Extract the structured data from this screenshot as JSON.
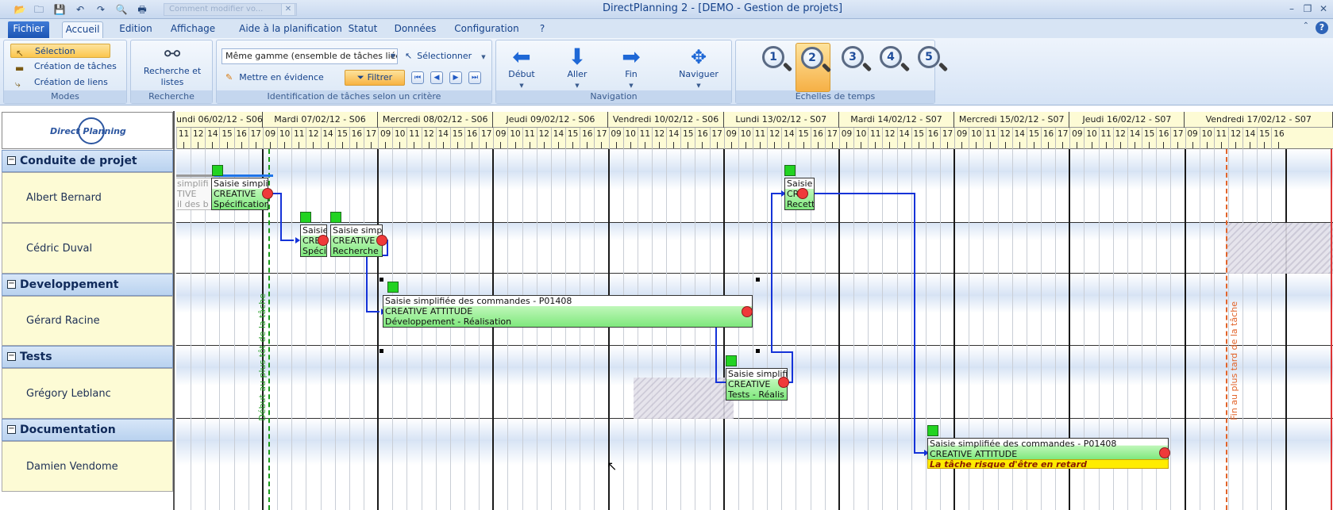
{
  "titlebar": {
    "document_tab": "Comment modifier vo...",
    "title": "DirectPlanning 2 - [DEMO - Gestion de projets]",
    "quick_access_icons": [
      "open-icon",
      "folder-icon",
      "save-icon",
      "undo-icon",
      "redo-icon",
      "print-preview-icon",
      "print-icon"
    ]
  },
  "tabs": [
    "Fichier",
    "Accueil",
    "Edition",
    "Affichage",
    "Aide à la planification",
    "Statut",
    "Données",
    "Configuration",
    "?"
  ],
  "ribbon": {
    "modes": {
      "label": "Modes",
      "items": [
        "Sélection",
        "Création de tâches",
        "Création de liens"
      ],
      "selected": "Sélection"
    },
    "recherche": {
      "label": "Recherche",
      "button": "Recherche et listes"
    },
    "identification": {
      "label": "Identification de tâches selon un critère",
      "combo_value": "Même gamme (ensemble de tâches liée",
      "select_button": "Sélectionner",
      "highlight_button": "Mettre en évidence",
      "filter_button": "Filtrer"
    },
    "navigation": {
      "label": "Navigation",
      "buttons": [
        "Début",
        "Aller",
        "Fin",
        "Naviguer"
      ]
    },
    "echelles": {
      "label": "Echelles de temps",
      "levels": [
        "1",
        "2",
        "3",
        "4",
        "5"
      ],
      "active": "2"
    }
  },
  "gantt": {
    "logo_text": "Direct Planning",
    "days": [
      "undi 06/02/12 - S06",
      "Mardi 07/02/12 - S06",
      "Mercredi 08/02/12 - S06",
      "Jeudi 09/02/12 - S06",
      "Vendredi 10/02/12 - S06",
      "Lundi 13/02/12 - S07",
      "Mardi 14/02/12 - S07",
      "Mercredi 15/02/12 - S07",
      "Jeudi 16/02/12 - S07",
      "Vendredi 17/02/12 - S07"
    ],
    "hours_first_day": [
      "11",
      "12",
      "14",
      "15",
      "16",
      "17"
    ],
    "hours_full_day": [
      "09",
      "10",
      "11",
      "12",
      "14",
      "15",
      "16",
      "17"
    ],
    "hours_last_day": [
      "09",
      "10",
      "11",
      "12",
      "14",
      "15",
      "16"
    ],
    "groups": [
      "Conduite de projet",
      "Developpement",
      "Tests",
      "Documentation"
    ],
    "resources": [
      "Albert Bernard",
      "Cédric Duval",
      "Gérard Racine",
      "Grégory Leblanc",
      "Damien Vendome"
    ],
    "tasks": {
      "ghost": [
        "simplifi",
        "TIVE",
        "il des b"
      ],
      "t1": [
        "Saisie simplifi",
        "CREATIVE",
        "Spécification"
      ],
      "t2": [
        "Saisie",
        "CREA",
        "Spécif"
      ],
      "t3": [
        "Saisie simplifi",
        "CREATIVE",
        "Recherche d"
      ],
      "t4": [
        "Saisie simplifiée des commandes - P01408",
        "CREATIVE ATTITUDE",
        "Développement - Réalisation"
      ],
      "t5": [
        "Saisie",
        "CRE",
        "Recett"
      ],
      "t6": [
        "Saisie simplifi",
        "CREATIVE",
        "Tests - Réalis"
      ],
      "t7": [
        "Saisie simplifiée des commandes - P01408",
        "CREATIVE ATTITUDE"
      ],
      "t7_warning": "La tâche risque d'être en retard"
    },
    "start_line_label": "Début au plus tôt de la tâche",
    "end_line_label": "Fin au plus tard de la tâche"
  }
}
